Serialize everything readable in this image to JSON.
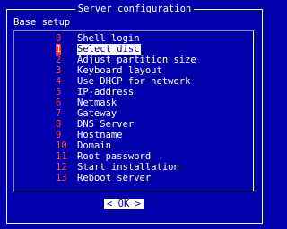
{
  "dialog": {
    "title": "Server configuration",
    "subtitle": "Base setup"
  },
  "menu": {
    "items": [
      {
        "num": "0",
        "label": "Shell login"
      },
      {
        "num": "1",
        "label": "Select disc"
      },
      {
        "num": "2",
        "label": "Adjust partition size"
      },
      {
        "num": "3",
        "label": "Keyboard layout"
      },
      {
        "num": "4",
        "label": "Use DHCP for network"
      },
      {
        "num": "5",
        "label": "IP-address"
      },
      {
        "num": "6",
        "label": "Netmask"
      },
      {
        "num": "7",
        "label": "Gateway"
      },
      {
        "num": "8",
        "label": "DNS Server"
      },
      {
        "num": "9",
        "label": "Hostname"
      },
      {
        "num": "10",
        "label": "Domain"
      },
      {
        "num": "11",
        "label": "Root password"
      },
      {
        "num": "12",
        "label": "Start installation"
      },
      {
        "num": "13",
        "label": "Reboot server"
      }
    ],
    "selected_index": 1
  },
  "buttons": {
    "ok_left": "<",
    "ok_label": "OK",
    "ok_right": ">"
  },
  "colors": {
    "background": "#0000aa",
    "text": "#ffffff",
    "hotkey": "#ff4444"
  }
}
